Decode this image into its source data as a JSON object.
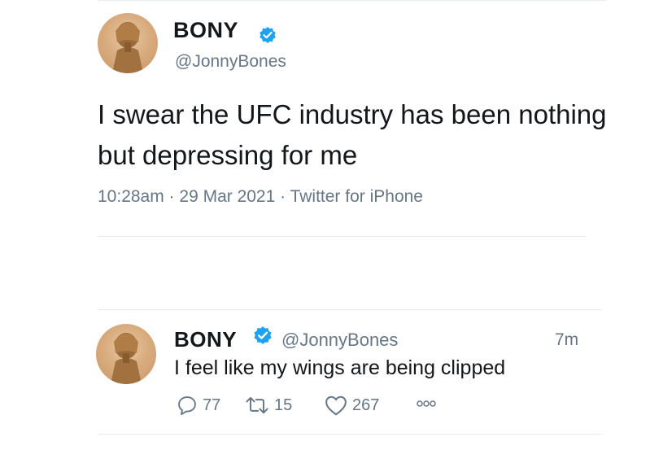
{
  "colors": {
    "text": "#14171a",
    "secondary": "#657786",
    "verified": "#1da1f2",
    "divider": "#e6ecf0"
  },
  "icons": [
    "verified-badge-icon",
    "reply-icon",
    "retweet-icon",
    "like-icon",
    "more-icon"
  ],
  "tweet_main": {
    "display_name": "BONY",
    "handle": "@JonnyBones",
    "text": "I swear the UFC industry has been nothing but depressing for me",
    "meta": "10:28am · 29 Mar 2021 · Twitter for iPhone"
  },
  "tweet_reply": {
    "display_name": "BONY",
    "handle": "@JonnyBones",
    "time": "7m",
    "text": "I feel like my wings are being clipped",
    "reply_count": "77",
    "retweet_count": "15",
    "like_count": "267"
  }
}
